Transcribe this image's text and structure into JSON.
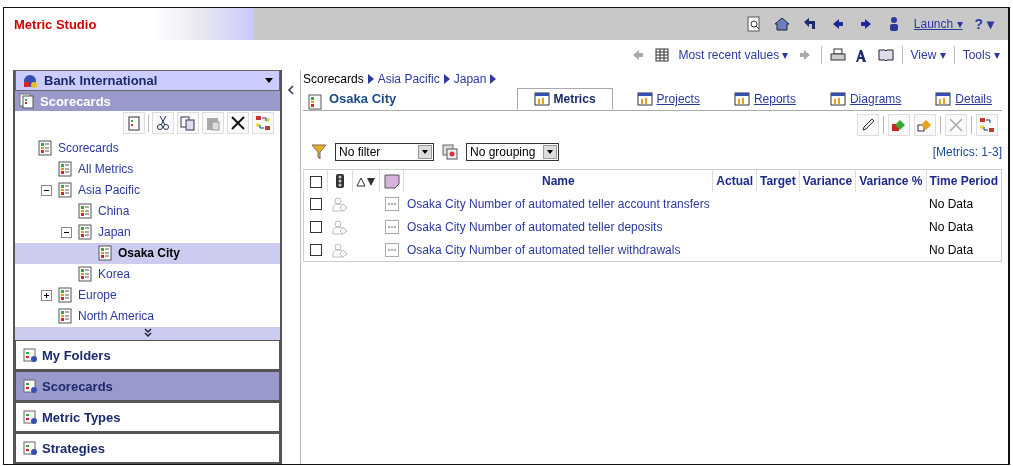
{
  "app": {
    "title": "Metric Studio"
  },
  "top_toolbar": {
    "launch": "Launch ▾",
    "help": "? ▾"
  },
  "second_toolbar": {
    "values_menu": "Most recent values ▾",
    "view_menu": "View ▾",
    "tools_menu": "Tools ▾"
  },
  "sidebar": {
    "package": "Bank International",
    "section_title": "Scorecards",
    "tree": [
      {
        "label": "Scorecards",
        "selected": false,
        "children": [
          {
            "label": "All Metrics",
            "selected": false
          },
          {
            "label": "Asia Pacific",
            "selected": false,
            "expanded": true,
            "children": [
              {
                "label": "China",
                "selected": false
              },
              {
                "label": "Japan",
                "selected": false,
                "expanded": true,
                "children": [
                  {
                    "label": "Osaka City",
                    "selected": true
                  }
                ]
              },
              {
                "label": "Korea",
                "selected": false
              }
            ]
          },
          {
            "label": "Europe",
            "selected": false,
            "expanded": false
          },
          {
            "label": "North America",
            "selected": false
          }
        ]
      }
    ],
    "nav": [
      {
        "label": "My Folders",
        "selected": false
      },
      {
        "label": "Scorecards",
        "selected": true
      },
      {
        "label": "Metric Types",
        "selected": false
      },
      {
        "label": "Strategies",
        "selected": false
      }
    ]
  },
  "breadcrumb": [
    "Scorecards",
    "Asia Pacific",
    "Japan"
  ],
  "page_title": "Osaka City",
  "tabs": [
    {
      "label": "Metrics",
      "selected": true
    },
    {
      "label": "Projects",
      "selected": false
    },
    {
      "label": "Reports",
      "selected": false
    },
    {
      "label": "Diagrams",
      "selected": false
    },
    {
      "label": "Details",
      "selected": false
    }
  ],
  "filter": {
    "value": "No filter"
  },
  "grouping": {
    "value": "No grouping"
  },
  "count": "[Metrics: 1-3]",
  "table": {
    "select_all": {
      "checked": false
    },
    "columns": [
      "Name",
      "Actual",
      "Target",
      "Variance",
      "Variance %",
      "Time Period"
    ],
    "rows": [
      {
        "checked": false,
        "name": "Osaka City Number of automated teller account transfers",
        "time_period": "No Data"
      },
      {
        "checked": false,
        "name": "Osaka City Number of automated teller deposits",
        "time_period": "No Data"
      },
      {
        "checked": false,
        "name": "Osaka City Number of automated teller withdrawals",
        "time_period": "No Data"
      }
    ]
  }
}
